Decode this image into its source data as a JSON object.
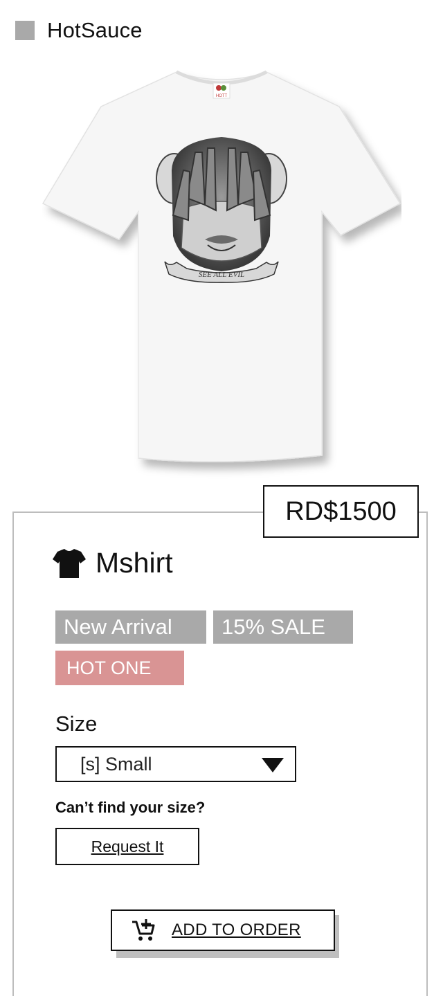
{
  "header": {
    "brand": "HotSauce",
    "logo_color": "#a9a9a9"
  },
  "product": {
    "image_icon": "white-tshirt-monkey-print",
    "price": "RD$1500",
    "name": "Mshirt",
    "name_icon": "tshirt-icon",
    "badges": [
      {
        "label": "New Arrival",
        "color": "#a9a9a9"
      },
      {
        "label": "15% SALE",
        "color": "#a9a9a9"
      },
      {
        "label": "HOT ONE",
        "color": "#d99494"
      }
    ],
    "print_caption": "SEE ALL EVIL",
    "tag_text": "HOTT"
  },
  "size": {
    "label": "Size",
    "selected": "[s] Small",
    "cant_find": "Can’t find your size?",
    "request_label": "Request It"
  },
  "cart": {
    "add_label": "ADD TO ORDER",
    "icon": "add-to-cart-icon"
  }
}
